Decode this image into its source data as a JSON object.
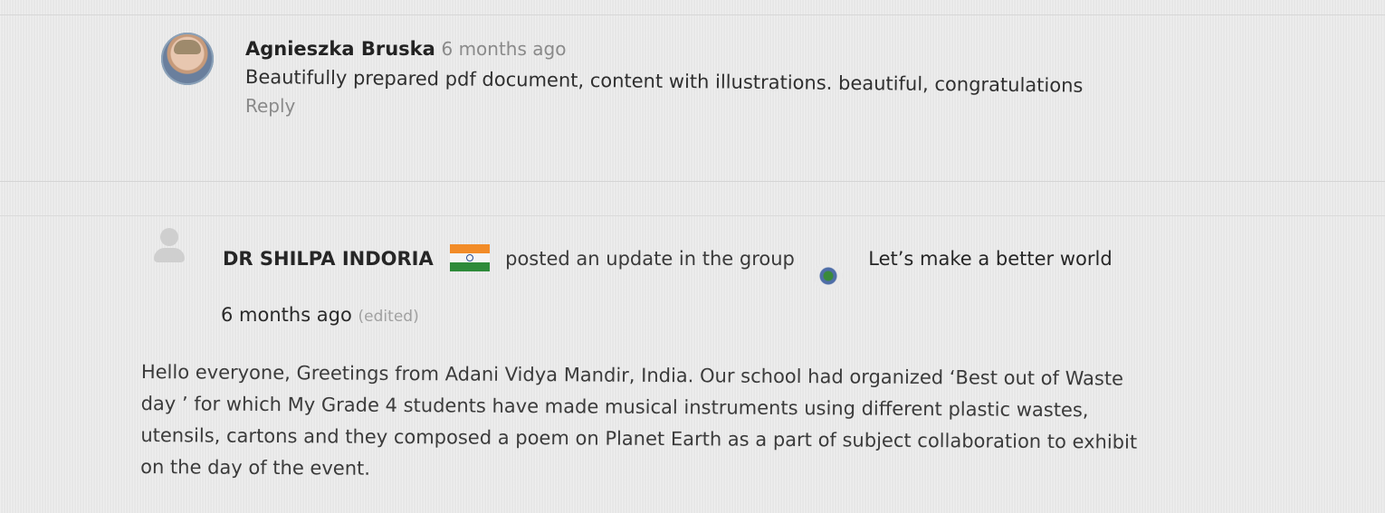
{
  "comment": {
    "author": "Agnieszka Bruska",
    "time_ago": "6 months ago",
    "text": "Beautifully prepared pdf document, content with illustrations. beautiful, congratulations",
    "reply_label": "Reply"
  },
  "update": {
    "poster_name": "DR SHILPA INDORIA",
    "action": "posted an update in the group",
    "group_name": "Let’s make a better world",
    "time_ago": "6 months ago",
    "edited_label": "(edited)",
    "content": "Hello everyone, Greetings from Adani Vidya Mandir, India. Our school had organized ‘Best out of Waste day ’ for which My Grade 4 students have made musical instruments using different plastic wastes, utensils, cartons and they composed a poem on Planet Earth as a part of subject collaboration to exhibit on the day of the event."
  },
  "icons": {
    "comment_avatar": "user-photo-avatar",
    "update_avatar": "default-user-avatar",
    "flag": "india-flag-icon",
    "group": "group-avatar-icon"
  },
  "colors": {
    "background": "#e9e9e9",
    "muted_text": "#8a8a8a",
    "flag_saffron": "#f28c28",
    "flag_green": "#2e8b3a"
  }
}
